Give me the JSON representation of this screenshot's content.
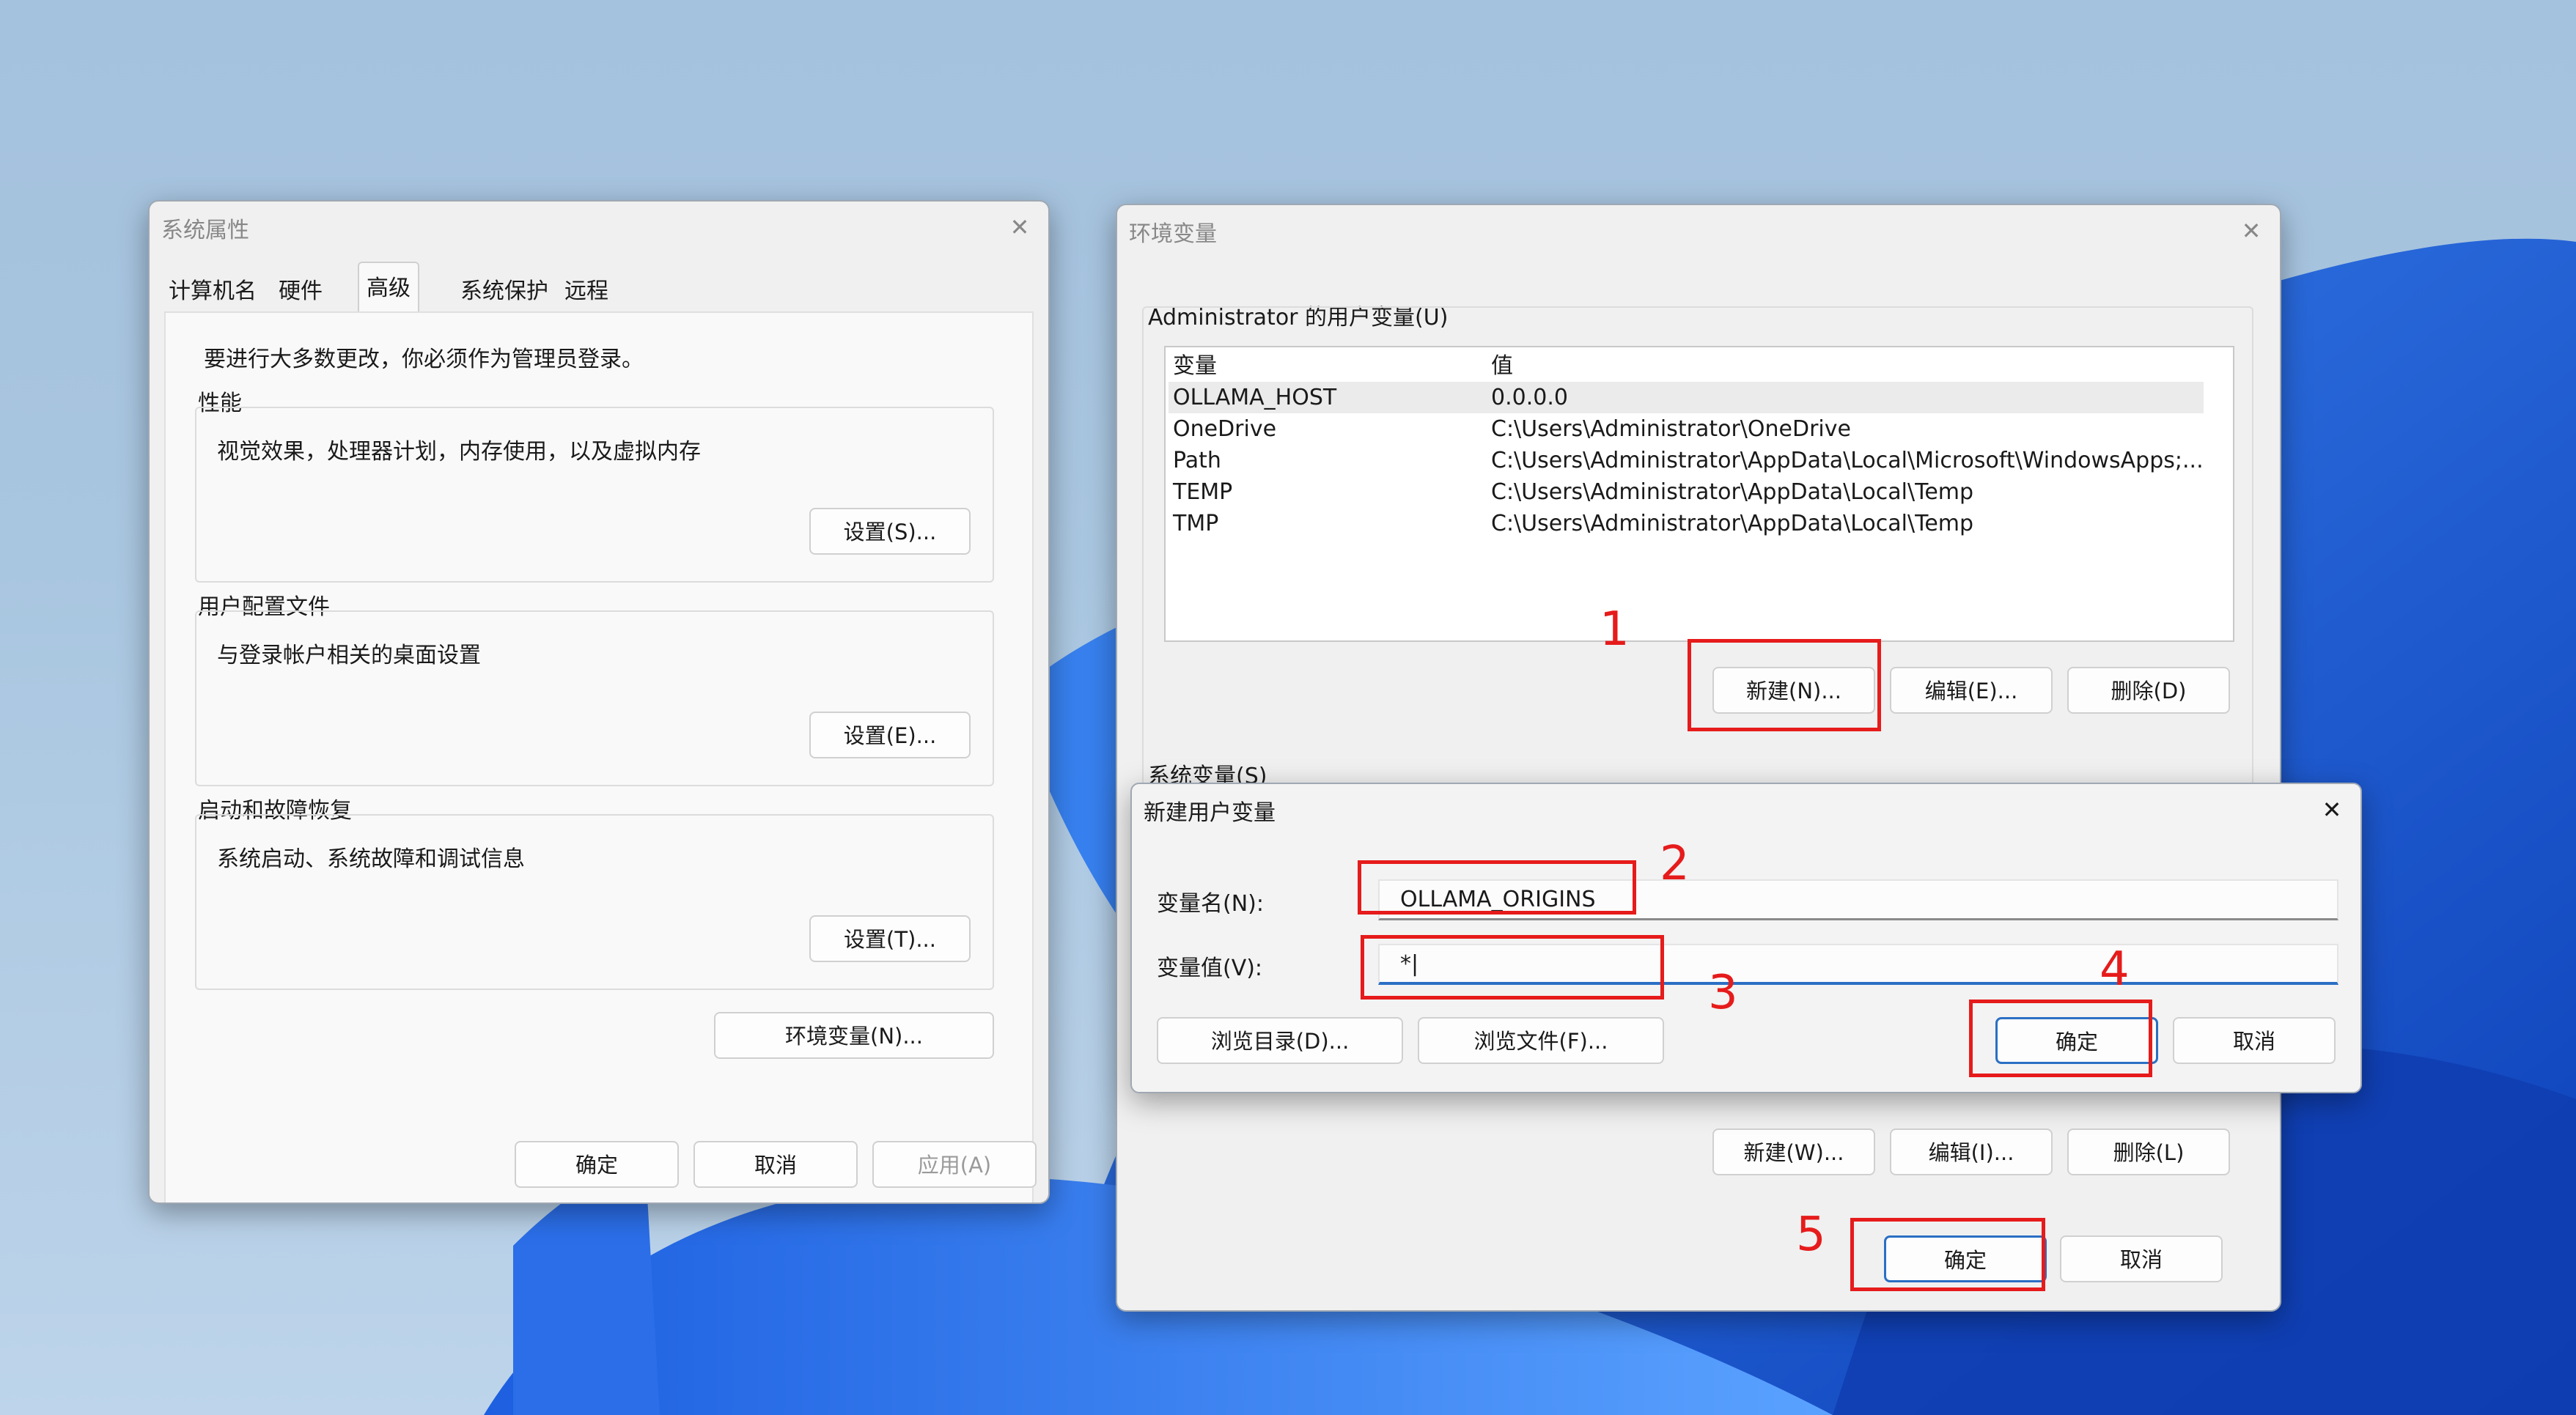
{
  "system_properties": {
    "title": "系统属性",
    "tabs": [
      "计算机名",
      "硬件",
      "高级",
      "系统保护",
      "远程"
    ],
    "admin_note": "要进行大多数更改，你必须作为管理员登录。",
    "performance": {
      "title": "性能",
      "desc": "视觉效果，处理器计划，内存使用，以及虚拟内存",
      "button": "设置(S)..."
    },
    "user_profiles": {
      "title": "用户配置文件",
      "desc": "与登录帐户相关的桌面设置",
      "button": "设置(E)..."
    },
    "startup_recovery": {
      "title": "启动和故障恢复",
      "desc": "系统启动、系统故障和调试信息",
      "button": "设置(T)..."
    },
    "env_button": "环境变量(N)...",
    "ok": "确定",
    "cancel": "取消",
    "apply": "应用(A)"
  },
  "env_vars": {
    "title": "环境变量",
    "user_section_label": "Administrator 的用户变量(U)",
    "headers": {
      "name": "变量",
      "value": "值"
    },
    "user_vars": [
      {
        "name": "OLLAMA_HOST",
        "value": "0.0.0.0"
      },
      {
        "name": "OneDrive",
        "value": "C:\\Users\\Administrator\\OneDrive"
      },
      {
        "name": "Path",
        "value": "C:\\Users\\Administrator\\AppData\\Local\\Microsoft\\WindowsApps;..."
      },
      {
        "name": "TEMP",
        "value": "C:\\Users\\Administrator\\AppData\\Local\\Temp"
      },
      {
        "name": "TMP",
        "value": "C:\\Users\\Administrator\\AppData\\Local\\Temp"
      }
    ],
    "user_buttons": {
      "new": "新建(N)...",
      "edit": "编辑(E)...",
      "delete": "删除(D)"
    },
    "system_section_label": "系统变量(S)",
    "system_buttons": {
      "new": "新建(W)...",
      "edit": "编辑(I)...",
      "delete": "删除(L)"
    },
    "ok": "确定",
    "cancel": "取消"
  },
  "new_user_var": {
    "title": "新建用户变量",
    "name_label": "变量名(N):",
    "name_value": "OLLAMA_ORIGINS",
    "value_label": "变量值(V):",
    "value_value": "*",
    "browse_dir": "浏览目录(D)...",
    "browse_file": "浏览文件(F)...",
    "ok": "确定",
    "cancel": "取消"
  },
  "annotations": [
    "1",
    "2",
    "3",
    "4",
    "5"
  ],
  "colors": {
    "annotation_red": "#e61b1b",
    "accent_blue": "#2a6fc4",
    "wallpaper_blue": "#1d5fe0"
  }
}
